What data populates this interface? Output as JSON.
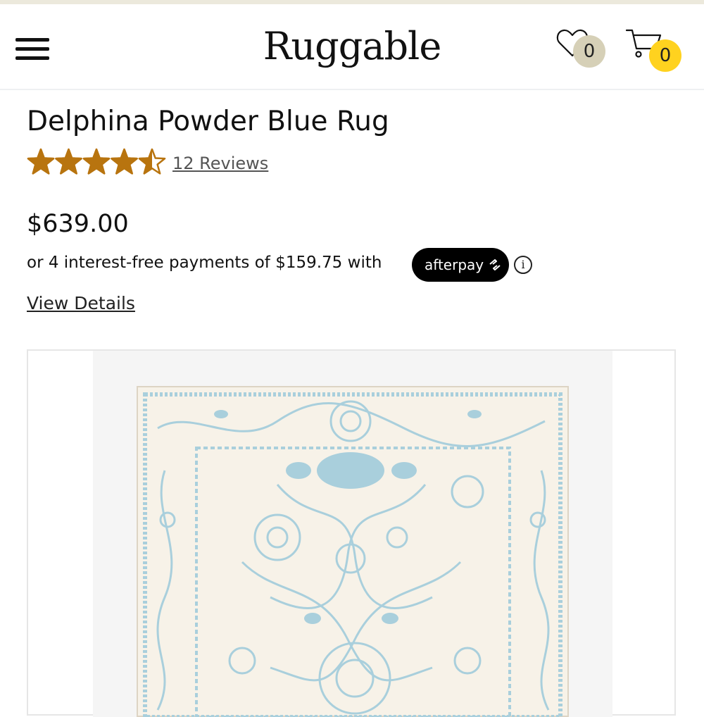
{
  "header": {
    "logo": "Ruggable",
    "wishlist_count": "0",
    "cart_count": "0",
    "wishlist_badge_color": "#d6d0b7",
    "cart_badge_color": "#ffd21f"
  },
  "product": {
    "title": "Delphina Powder Blue Rug",
    "rating": 4.5,
    "rating_max": 5,
    "star_color": "#b8740f",
    "reviews_label": "12 Reviews",
    "price": "$639.00",
    "installments_text": "or 4 interest-free payments of $159.75 with",
    "afterpay_label": "afterpay",
    "info_glyph": "i",
    "view_details_label": "View Details"
  },
  "image": {
    "rug_accent_color": "#a9cfdc",
    "rug_base_color": "#f7f2e8"
  },
  "icons": [
    "menu-icon",
    "heart-icon",
    "cart-icon",
    "star-icon",
    "afterpay-arrows-icon",
    "info-icon"
  ]
}
